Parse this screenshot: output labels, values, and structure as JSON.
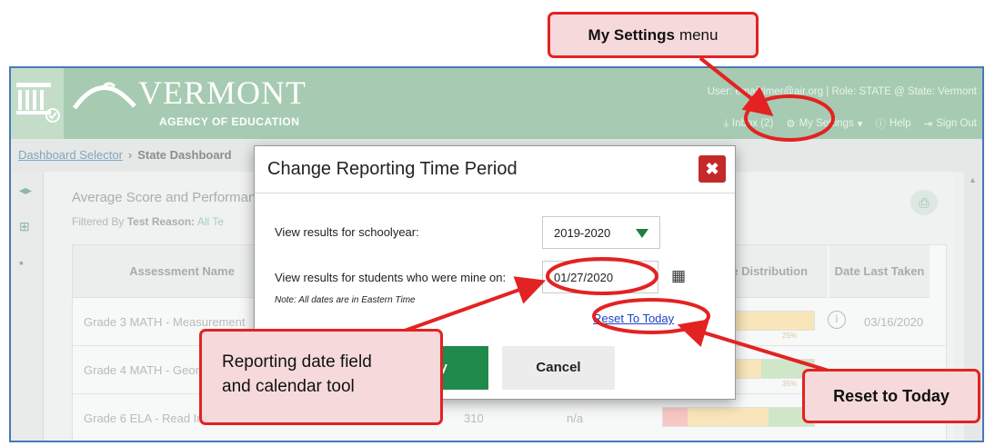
{
  "header": {
    "logo_text": "VERMONT",
    "logo_sub": "AGENCY OF EDUCATION",
    "user_info": "User: emailtimer@air.org  |  Role: STATE @ State: Vermont",
    "nav": {
      "inbox": "Inbox (2)",
      "settings": "My Settings",
      "help": "Help",
      "signout": "Sign Out"
    }
  },
  "breadcrumb": {
    "link": "Dashboard Selector",
    "current": "State Dashboard"
  },
  "card": {
    "title": "Average Score and Performance",
    "filter_label": "Filtered By",
    "filter_key": "Test Reason:",
    "filter_value": "All Te"
  },
  "table": {
    "headers": {
      "assessment": "Assessment Name",
      "distribution": "Performance Distribution",
      "date": "Date Last Taken"
    },
    "rows": [
      {
        "name": "Grade 3 MATH - Measurement",
        "score": "",
        "col2": "",
        "date": "03/16/2020",
        "pct_label": "25%"
      },
      {
        "name": "Grade 4 MATH - Geometry",
        "score": "",
        "col2": "",
        "date": "",
        "pct_label": "35%"
      },
      {
        "name": "Grade 6 ELA - Read In",
        "score": "310",
        "col2": "n/a",
        "date": "",
        "pct_label": "16%  54%  30%"
      }
    ]
  },
  "modal": {
    "title": "Change Reporting Time Period",
    "schoolyear_label": "View results for schoolyear:",
    "schoolyear_value": "2019-2020",
    "date_label": "View results for students who were mine on:",
    "date_value": "01/27/2020",
    "note": "Note: All dates are in Eastern Time",
    "reset_link": "Reset To Today",
    "apply": "Apply",
    "cancel": "Cancel"
  },
  "callouts": {
    "settings_bold": "My Settings",
    "settings_rest": "menu",
    "date_line1": "Reporting date field",
    "date_line2": "and calendar tool",
    "reset": "Reset to Today"
  },
  "colors": {
    "header_green": "#a6cbb2",
    "callout_red": "#e32222",
    "callout_fill": "#f6dadb",
    "apply_green": "#1f8a4c",
    "close_red": "#c42a2a",
    "link_blue": "#1b43c9"
  }
}
